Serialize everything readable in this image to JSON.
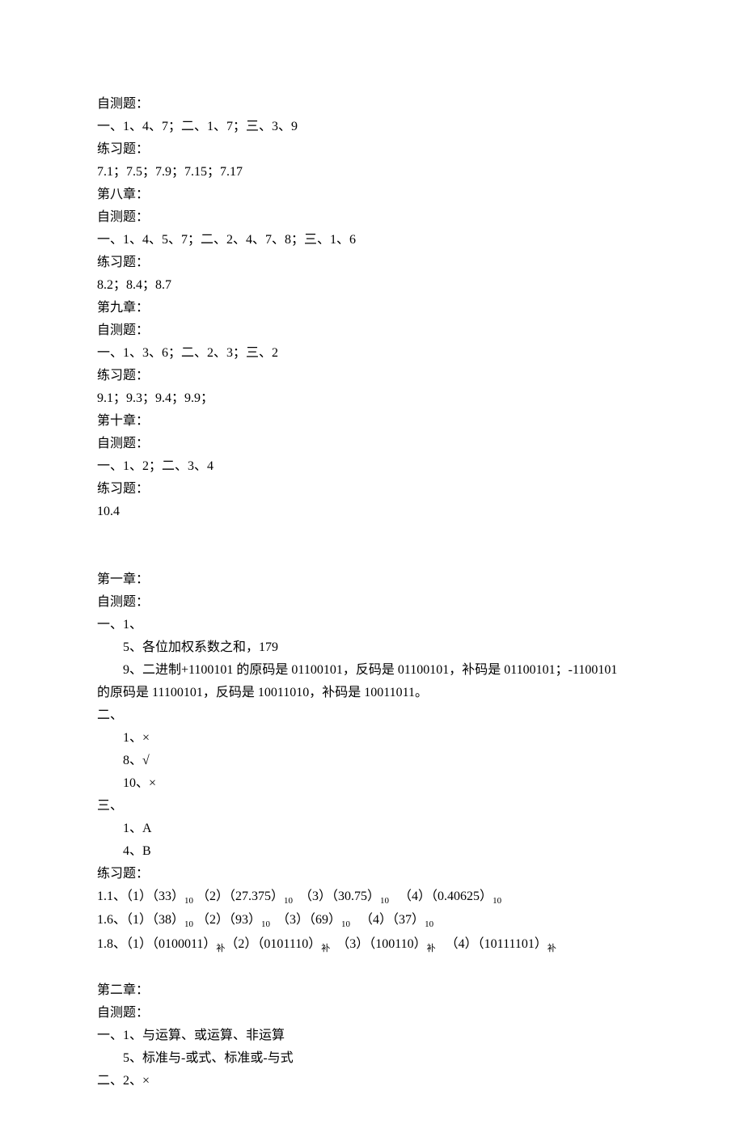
{
  "lines": [
    {
      "text": "自测题：",
      "indent": 0
    },
    {
      "text": "一、1、4、7；二、1、7；三、3、9",
      "indent": 0
    },
    {
      "text": "练习题：",
      "indent": 0
    },
    {
      "text": "7.1；7.5；7.9；7.15；7.17",
      "indent": 0
    },
    {
      "text": "第八章：",
      "indent": 0
    },
    {
      "text": "自测题：",
      "indent": 0
    },
    {
      "text": "一、1、4、5、7；二、2、4、7、8；三、1、6",
      "indent": 0
    },
    {
      "text": "练习题：",
      "indent": 0
    },
    {
      "text": "8.2；8.4；8.7",
      "indent": 0
    },
    {
      "text": "第九章：",
      "indent": 0
    },
    {
      "text": "自测题：",
      "indent": 0
    },
    {
      "text": "一、1、3、6；二、2、3；三、2",
      "indent": 0
    },
    {
      "text": "练习题：",
      "indent": 0
    },
    {
      "text": "9.1；9.3；9.4；9.9；",
      "indent": 0
    },
    {
      "text": "第十章：",
      "indent": 0
    },
    {
      "text": "自测题：",
      "indent": 0
    },
    {
      "text": "一、1、2；二、3、4",
      "indent": 0
    },
    {
      "text": "练习题：",
      "indent": 0
    },
    {
      "text": "10.4",
      "indent": 0
    },
    {
      "spacer": true
    },
    {
      "spacer": true
    },
    {
      "text": "第一章：",
      "indent": 0
    },
    {
      "text": "自测题：",
      "indent": 0
    },
    {
      "text": "一、1、",
      "indent": 0
    },
    {
      "text": "5、各位加权系数之和，179",
      "indent": 1
    },
    {
      "text": "9、二进制+1100101 的原码是 01100101，反码是 01100101，补码是 01100101；-1100101",
      "indent": 1
    },
    {
      "text": "的原码是 11100101，反码是 10011010，补码是 10011011。",
      "indent": 0
    },
    {
      "text": "二、",
      "indent": 0
    },
    {
      "text": "1、×",
      "indent": 1
    },
    {
      "text": "8、√",
      "indent": 1
    },
    {
      "text": "10、×",
      "indent": 1
    },
    {
      "text": "三、",
      "indent": 0
    },
    {
      "text": "1、A",
      "indent": 1
    },
    {
      "text": "4、B",
      "indent": 1
    },
    {
      "text": "练习题：",
      "indent": 0
    },
    {
      "html": "1.1、（1）（33）<span class=\"sub\">10</span> （2）（27.375）<span class=\"sub\">10</span>  （3）（30.75）<span class=\"sub\">10</span>   （4）（0.40625）<span class=\"sub\">10</span>",
      "indent": 0
    },
    {
      "html": "1.6、（1）（38）<span class=\"sub\">10</span> （2）（93）<span class=\"sub\">10</span>  （3）（69）<span class=\"sub\">10</span>   （4）（37）<span class=\"sub\">10</span>",
      "indent": 0
    },
    {
      "html": "1.8、（1）（0100011）<span class=\"sub\">补</span>（2）（0101110）<span class=\"sub\">补</span>  （3）（100110）<span class=\"sub\">补</span>   （4）（10111101）<span class=\"sub\">补</span>",
      "indent": 0
    },
    {
      "spacer": true
    },
    {
      "text": "第二章：",
      "indent": 0
    },
    {
      "text": "自测题：",
      "indent": 0
    },
    {
      "text": "一、1、与运算、或运算、非运算",
      "indent": 0
    },
    {
      "text": "5、标准与-或式、标准或-与式",
      "indent": 1
    },
    {
      "text": "二、2、×",
      "indent": 0
    }
  ]
}
